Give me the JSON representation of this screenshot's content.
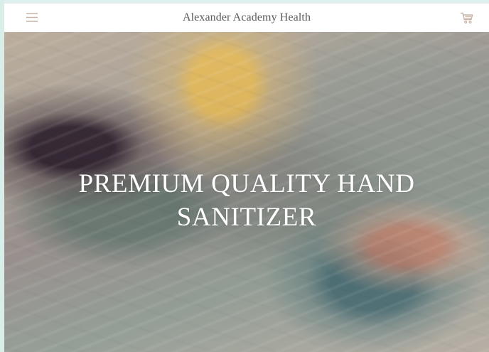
{
  "header": {
    "title": "Alexander Academy Health",
    "menu_icon": "hamburger-menu-icon",
    "cart_icon": "shopping-cart-icon"
  },
  "hero": {
    "headline_line_1": "PREMIUM QUALITY HAND",
    "headline_line_2": "SANITIZER"
  },
  "colors": {
    "page_background": "#dff1ee",
    "header_background": "#ffffff",
    "header_text": "#5d5a58",
    "hero_text": "#ffffff",
    "icon_color": "#c9b4a7"
  }
}
